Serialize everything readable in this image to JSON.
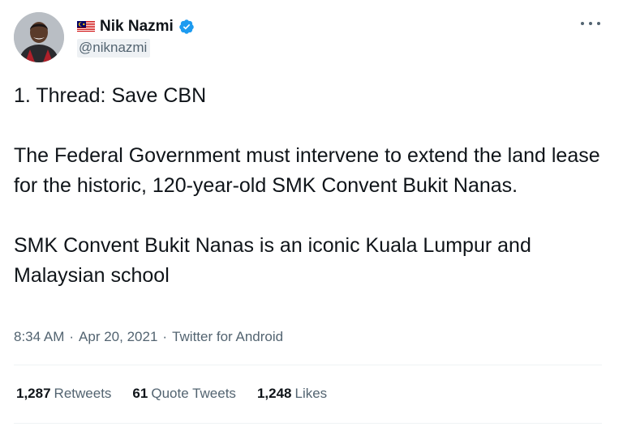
{
  "author": {
    "display_name": "Nik Nazmi",
    "handle": "@niknazmi",
    "verified": true,
    "flag": "malaysia-flag-icon"
  },
  "tweet": {
    "paragraphs": [
      "1. Thread: Save CBN",
      "The Federal Government must intervene to extend the land lease for the historic, 120-year-old SMK Convent Bukit Nanas.",
      "SMK Convent Bukit Nanas is an iconic Kuala Lumpur and Malaysian school"
    ],
    "time": "8:34 AM",
    "date": "Apr 20, 2021",
    "source": "Twitter for Android",
    "separator": "·"
  },
  "stats": {
    "retweets": {
      "count": "1,287",
      "label": "Retweets"
    },
    "quote_tweets": {
      "count": "61",
      "label": "Quote Tweets"
    },
    "likes": {
      "count": "1,248",
      "label": "Likes"
    }
  },
  "colors": {
    "verified_blue": "#1d9bf0",
    "text_primary": "#0f1419",
    "text_secondary": "#536471"
  }
}
